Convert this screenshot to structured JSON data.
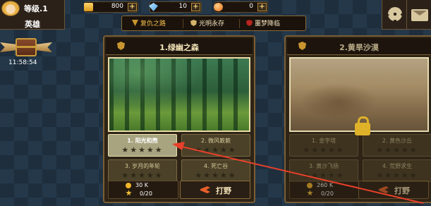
{
  "player": {
    "level": "等级.1",
    "title": "英雄",
    "timer": "11:58:54"
  },
  "currencies": {
    "gold": "800",
    "gem": "10",
    "orb": "0",
    "plus": "+"
  },
  "tabs": [
    "复仇之路",
    "光明永存",
    "噩梦降临"
  ],
  "chapters": [
    {
      "title": "1.绿幽之森",
      "stages": [
        {
          "name": "1. 阳光和煦",
          "stars": "★★★★★"
        },
        {
          "name": "2. 微风簌簌",
          "stars": "★★★★★"
        },
        {
          "name": "3. 岁月的年轮",
          "stars": "★★★★★"
        },
        {
          "name": "4. 死亡谷",
          "stars": "★★★★★"
        }
      ],
      "gold": "30 K",
      "stars": "0/20",
      "fight": "打野"
    },
    {
      "title": "2.黄旱沙漠",
      "stages": [
        {
          "name": "1. 金字塔",
          "stars": "★★★★★"
        },
        {
          "name": "2. 黄色沙丘",
          "stars": "★★★★★"
        },
        {
          "name": "3. 黄沙飞扬",
          "stars": "★★★★★"
        },
        {
          "name": "4. 荒野求生",
          "stars": "★★★★★"
        }
      ],
      "gold": "260 K",
      "stars": "0/20",
      "fight": "打野"
    }
  ],
  "colors": {
    "background": "#24384a",
    "panel": "#2b2118",
    "border_gold": "#7a5e34",
    "accent_red": "#e8402a"
  },
  "icons": [
    "avatar",
    "chest-icon",
    "wing-icon",
    "gold-icon",
    "gem-icon",
    "orb-icon",
    "settings-gear-icon",
    "mail-icon",
    "shield-icon",
    "lock-icon",
    "star-icon",
    "fight-icon"
  ]
}
